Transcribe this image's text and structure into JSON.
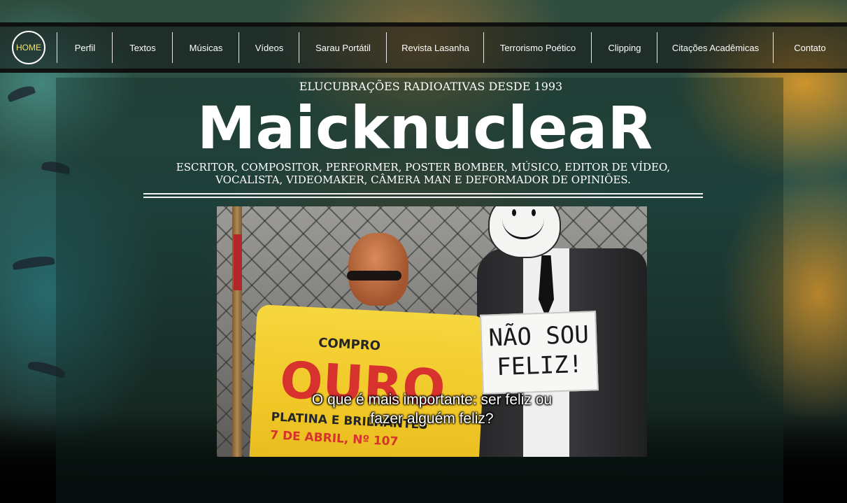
{
  "nav": {
    "items": [
      {
        "label": "HOME",
        "active": true
      },
      {
        "label": "Perfil"
      },
      {
        "label": "Textos"
      },
      {
        "label": "Músicas"
      },
      {
        "label": "Vídeos"
      },
      {
        "label": "Sarau Portátil"
      },
      {
        "label": "Revista Lasanha"
      },
      {
        "label": "Terrorismo Poético"
      },
      {
        "label": "Clipping"
      },
      {
        "label": "Citações Acadêmicas"
      },
      {
        "label": "Contato"
      }
    ]
  },
  "header": {
    "tagline": "ELUCUBRAÇÕES RADIOATIVAS DESDE 1993",
    "brand": "MaicknucleaR",
    "roles_line1": "ESCRITOR, COMPOSITOR, PERFORMER, POSTER BOMBER, MÚSICO, EDITOR DE VÍDEO,",
    "roles_line2": "VOCALISTA, VIDEOMAKER,  CÂMERA MAN E DEFORMADOR DE OPINIÕES."
  },
  "video": {
    "vest_compro": "COMPRO",
    "vest_ouro": "OURO",
    "vest_platina": "PLATINA E BRILHANTES",
    "vest_date": "7 DE ABRIL, Nº 107",
    "sign_line1": "NÃO SOU",
    "sign_line2": "FELIZ!",
    "subtitle_line1": "O que é mais importante: ser feliz ou",
    "subtitle_line2": "fazer alguém feliz?"
  },
  "colors": {
    "home_active": "#f0e27a",
    "nav_text": "#ffffff",
    "vest_yellow": "#f1c828",
    "vest_red": "#d8322e"
  }
}
